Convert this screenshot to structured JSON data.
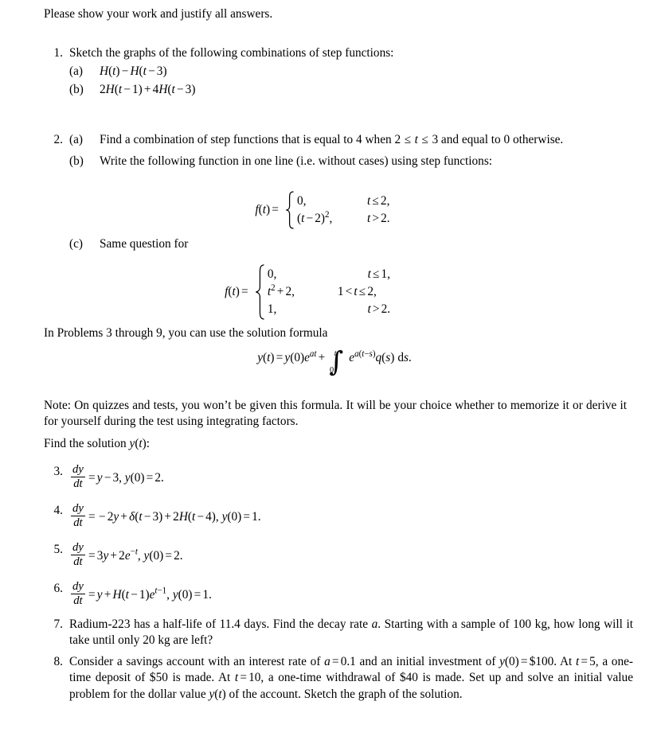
{
  "document": {
    "intro_line": "Please show your work and justify all answers.",
    "problems": [
      {
        "number": "1.",
        "stem": "Sketch the graphs of the following combinations of step functions:",
        "subitems": [
          {
            "label": "(a)",
            "text_math": "H(t) − H(t − 3)"
          },
          {
            "label": "(b)",
            "text_math": "2H(t − 1) + 4H(t − 3)"
          }
        ]
      },
      {
        "number": "2.",
        "subitems": [
          {
            "label": "(a)",
            "text": "Find a combination of step functions that is equal to 4 when 2 ≤ t ≤ 3 and equal to 0 otherwise."
          },
          {
            "label": "(b)",
            "text": "Write the following function in one line (i.e. without cases) using step functions:"
          },
          {
            "label": "(c)",
            "text": "Same question for"
          }
        ]
      },
      {
        "number": "7.",
        "text": "Radium-223 has a half-life of 11.4 days. Find the decay rate a. Starting with a sample of 100 kg, how long will it take until only 20 kg are left?"
      },
      {
        "number": "8.",
        "text": "Consider a savings account with an interest rate of a = 0.1 and an initial investment of y(0) = $100. At t = 5, a one-time deposit of $50 is made. At t = 10, a one-time withdrawal of $40 is made. Set up and solve an initial value problem for the dollar value y(t) of the account. Sketch the graph of the solution."
      }
    ],
    "piecewise_1": {
      "lhs": "f(t) =",
      "rows": [
        {
          "value": "0,",
          "condition": "t ≤ 2,"
        },
        {
          "value": "(t − 2)²,",
          "condition": "t > 2."
        }
      ]
    },
    "piecewise_2": {
      "lhs": "f(t) =",
      "rows": [
        {
          "value": "0,",
          "condition": "t ≤ 1,"
        },
        {
          "value": "t² + 2,",
          "condition": "1 < t ≤ 2,"
        },
        {
          "value": "1,",
          "condition": "t > 2."
        }
      ]
    },
    "formula_lead": "In Problems 3 through 9, you can use the solution formula",
    "solution_formula": "y(t) = y(0)e^{at} + ∫₀ᵗ e^{a(t−s)} q(s) ds.",
    "note_paragraph": "Note: On quizzes and tests, you won’t be given this formula. It will be your choice whether to memorize it or derive it for yourself during the test using integrating factors.",
    "find_solution_line": "Find the solution y(t):",
    "ode_problems": [
      {
        "number": "3.",
        "equation": "dy/dt = y − 3, y(0) = 2."
      },
      {
        "number": "4.",
        "equation": "dy/dt = −2y + δ(t − 3) + 2H(t − 4), y(0) = 1."
      },
      {
        "number": "5.",
        "equation": "dy/dt = 3y + 2e^{−t}, y(0) = 2."
      },
      {
        "number": "6.",
        "equation": "dy/dt = y + H(t − 1)e^{t−1}, y(0) = 1."
      }
    ]
  }
}
